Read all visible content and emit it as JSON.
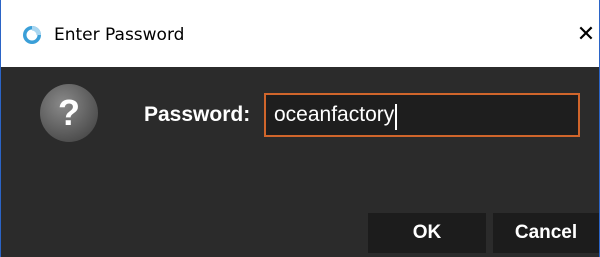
{
  "window": {
    "title": "Enter Password",
    "close_glyph": "✕",
    "app_icon": "app-logo-icon",
    "border_color": "#2b64c6"
  },
  "dialog": {
    "icon": "question-icon",
    "password_label": "Password:",
    "password_value": "oceanfactory",
    "input_border_color": "#d0652b",
    "background_color": "#2b2b2b"
  },
  "buttons": {
    "ok_label": "OK",
    "cancel_label": "Cancel"
  }
}
